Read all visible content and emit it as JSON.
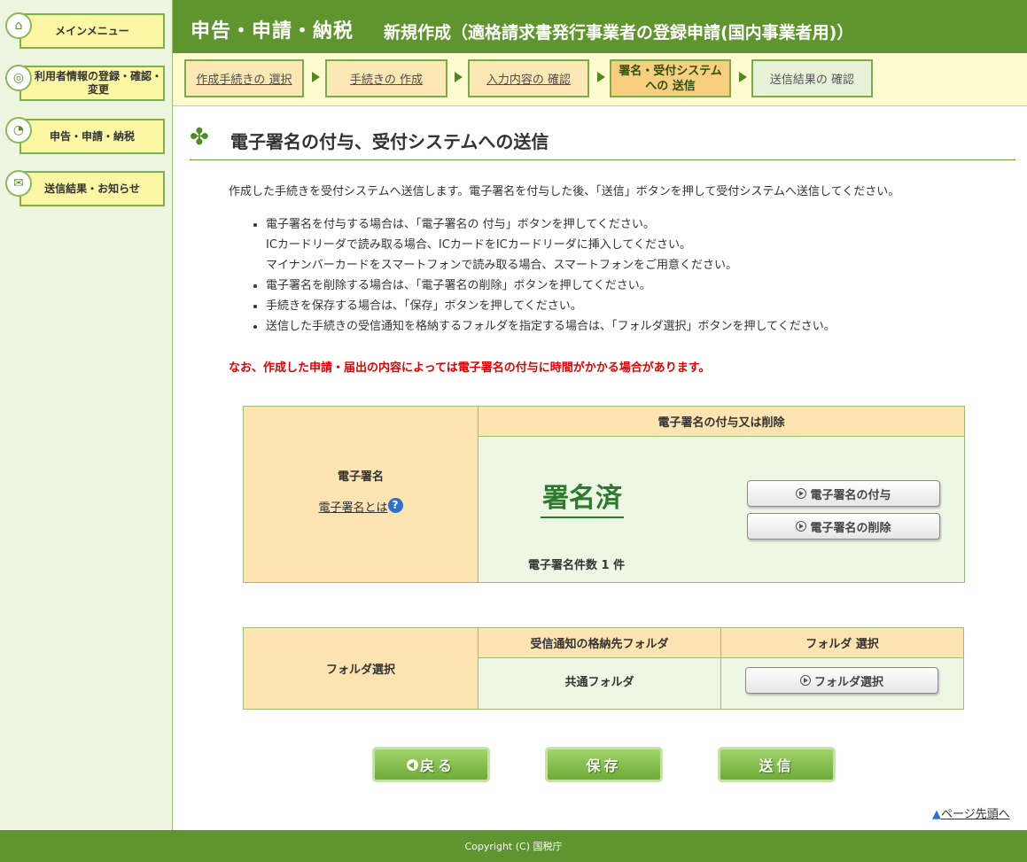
{
  "sidebar": {
    "items": [
      {
        "label": "メインメニュー"
      },
      {
        "label": "利用者情報の登録・確認・変更"
      },
      {
        "label": "申告・申請・納税"
      },
      {
        "label": "送信結果・お知らせ"
      }
    ]
  },
  "header": {
    "section": "申告・申請・納税",
    "subtitle": "新規作成（適格請求書発行事業者の登録申請(国内事業者用)）"
  },
  "steps": [
    {
      "label": "作成手続きの 選択",
      "state": "done"
    },
    {
      "label": "手続きの 作成",
      "state": "done"
    },
    {
      "label": "入力内容の 確認",
      "state": "done"
    },
    {
      "label": "署名・受付システムへの 送信",
      "state": "current"
    },
    {
      "label": "送信結果の 確認",
      "state": "next"
    }
  ],
  "page": {
    "title": "電子署名の付与、受付システムへの送信",
    "intro": "作成した手続きを受付システムへ送信します。電子署名を付与した後、「送信」ボタンを押して受付システムへ送信してください。",
    "bullets": [
      {
        "lines": [
          "電子署名を付与する場合は、「電子署名の 付与」ボタンを押してください。",
          "ICカードリーダで読み取る場合、ICカードをICカードリーダに挿入してください。",
          "マイナンバーカードをスマートフォンで読み取る場合、スマートフォンをご用意ください。"
        ]
      },
      {
        "lines": [
          "電子署名を削除する場合は、「電子署名の削除」ボタンを押してください。"
        ]
      },
      {
        "lines": [
          "手続きを保存する場合は、「保存」ボタンを押してください。"
        ]
      },
      {
        "lines": [
          "送信した手続きの受信通知を格納するフォルダを指定する場合は、「フォルダ選択」ボタンを押してください。"
        ]
      }
    ],
    "warning": "なお、作成した申請・届出の内容によっては電子署名の付与に時間がかかる場合があります。"
  },
  "signature": {
    "header": "電子署名の付与又は削除",
    "label": "電子署名",
    "help_link": "電子署名とは",
    "status": "署名済",
    "count_text": "電子署名件数 1  件",
    "add_button": "電子署名の付与",
    "delete_button": "電子署名の削除"
  },
  "folder": {
    "label": "フォルダ選択",
    "col1_header": "受信通知の格納先フォルダ",
    "col2_header": "フォルダ 選択",
    "value": "共通フォルダ",
    "select_button": "フォルダ選択"
  },
  "actions": {
    "back": "戻る",
    "save": "保存",
    "send": "送信"
  },
  "pagetop": "ページ先頭へ",
  "footer": "Copyright (C) 国税庁",
  "colors": {
    "header_green": "#5f952e",
    "warning_red": "#e00000",
    "sidebar_button_yellow": "#fbf6a4"
  }
}
